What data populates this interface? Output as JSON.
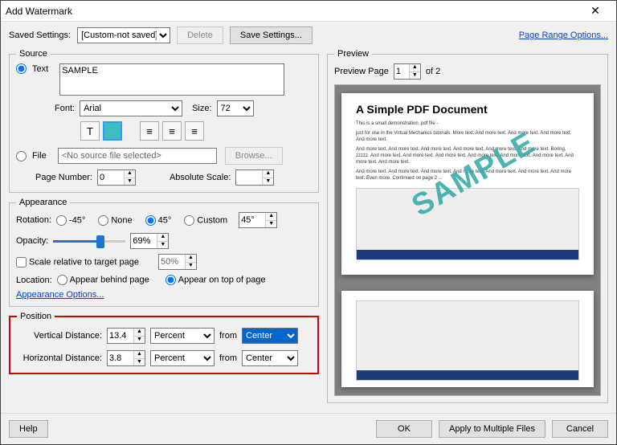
{
  "window": {
    "title": "Add Watermark"
  },
  "toolbar": {
    "saved_settings_label": "Saved Settings:",
    "saved_settings_value": "[Custom-not saved]",
    "delete": "Delete",
    "save_settings": "Save Settings...",
    "page_range": "Page Range Options..."
  },
  "source": {
    "legend": "Source",
    "text_radio": "Text",
    "text_value": "SAMPLE",
    "font_label": "Font:",
    "font_value": "Arial",
    "size_label": "Size:",
    "size_value": "72",
    "file_radio": "File",
    "file_value": "<No source file selected>",
    "browse": "Browse...",
    "page_number_label": "Page Number:",
    "page_number_value": "0",
    "abs_scale_label": "Absolute Scale:",
    "letter_icon": "T"
  },
  "appearance": {
    "legend": "Appearance",
    "rotation_label": "Rotation:",
    "minus45": "-45°",
    "none": "None",
    "plus45": "45°",
    "custom": "Custom",
    "custom_value": "45°",
    "opacity_label": "Opacity:",
    "opacity_value": "69%",
    "scale_relative": "Scale relative to target page",
    "scale_value": "50%",
    "location_label": "Location:",
    "behind": "Appear behind page",
    "ontop": "Appear on top of page",
    "link": "Appearance Options..."
  },
  "position": {
    "legend": "Position",
    "vdist_label": "Vertical Distance:",
    "vdist_value": "13.4",
    "hdist_label": "Horizontal Distance:",
    "hdist_value": "3.8",
    "unit": "Percent",
    "from": "from",
    "center": "Center"
  },
  "preview": {
    "legend": "Preview",
    "page_label": "Preview Page",
    "page_value": "1",
    "of": "of 2",
    "doc_title": "A Simple PDF Document",
    "subtitle": "This is a small demonstration .pdf file -",
    "para1": "just for use in the Virtual Mechanics tutorials. More text. And more text. And more text. And more text. And more text.",
    "para2": "And more text. And more text. And more text. And more text. And more text. And more text. Boring, zzzzz. And more text. And more text. And more text. And more text. And more text. And more text. And more text. And more text.",
    "para3": "And more text. And more text. And more text. And more text. And more text. And more text. And more text. Even more. Continued on page 2 ...",
    "stamp": "SAMPLE"
  },
  "buttons": {
    "help": "Help",
    "ok": "OK",
    "apply": "Apply to Multiple Files",
    "cancel": "Cancel"
  }
}
